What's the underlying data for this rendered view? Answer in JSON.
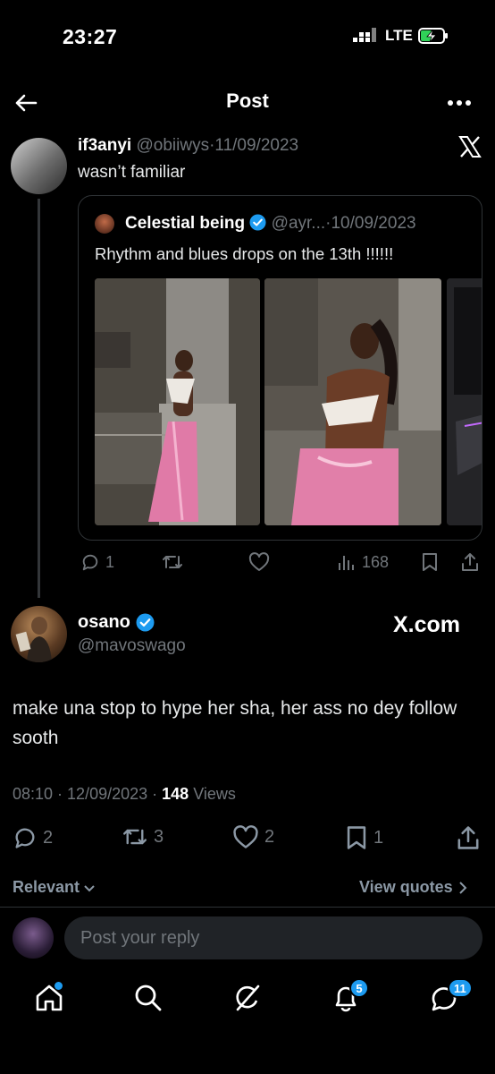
{
  "status_bar": {
    "time": "23:27",
    "network": "LTE"
  },
  "header": {
    "title": "Post"
  },
  "quoted_tweet": {
    "author_name": "if3anyi",
    "author_handle": "@obiiwys",
    "date": "11/09/2023",
    "text": "wasn’t familiar",
    "embedded": {
      "author_name": "Celestial being",
      "author_handle": "@ayr...",
      "date": "10/09/2023",
      "text": "Rhythm and blues drops on the 13th !!!!!!"
    },
    "actions": {
      "replies": "1",
      "views": "168"
    }
  },
  "main_post": {
    "author_name": "osano",
    "author_handle": "@mavoswago",
    "watermark": "X.com",
    "text": "make una stop to hype her sha, her ass no dey follow sooth",
    "time": "08:10",
    "date": "12/09/2023",
    "views_count": "148",
    "views_label": "Views",
    "actions": {
      "replies": "2",
      "reposts": "3",
      "likes": "2",
      "bookmarks": "1"
    }
  },
  "reply_sort": {
    "label": "Relevant",
    "view_quotes": "View quotes"
  },
  "reply_box": {
    "placeholder": "Post your reply"
  },
  "bottom_nav": {
    "notifications_badge": "5",
    "messages_badge": "11"
  },
  "colors": {
    "background": "#000000",
    "verified": "#1d9bf0",
    "muted": "#71767b",
    "badge": "#1d9bf0"
  }
}
